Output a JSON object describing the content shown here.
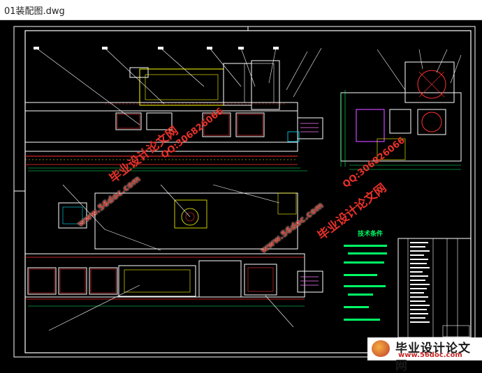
{
  "window": {
    "title": "01装配图.dwg"
  },
  "drawing": {
    "notes_title": "技术条件",
    "colors": {
      "background": "#000000",
      "frame": "#ffffff",
      "part": "#ffff00",
      "hidden": "#ff3030",
      "dims": "#00ff66",
      "purple": "#cc44ff",
      "cyan": "#00e5ff"
    }
  },
  "watermarks": {
    "site_cn": "毕业设计论文网",
    "site_url": "www.56doc.com",
    "qq": "QQ:306826066"
  },
  "logo": {
    "main": "毕业设计论文网",
    "url": "www.56doc.com",
    "icon": "logo-badge-icon"
  }
}
